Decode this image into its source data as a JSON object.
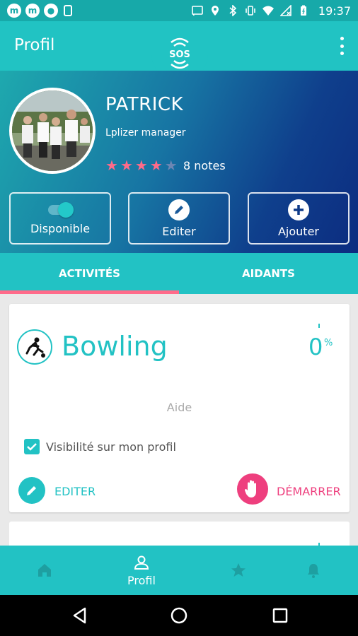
{
  "status_bar": {
    "time": "19:37",
    "app_icons": [
      "m",
      "m"
    ],
    "icons": [
      "cast-icon",
      "location-icon",
      "bluetooth-icon",
      "vibrate-icon",
      "wifi-icon",
      "signal-off-icon",
      "battery-icon"
    ]
  },
  "app_bar": {
    "title": "Profil",
    "logo_text": "SOS",
    "menu_icon": "more-vert-icon"
  },
  "profile": {
    "name": "PATRICK",
    "role": "Lplizer manager",
    "rating": 4,
    "rating_max": 5,
    "notes_label": "8 notes",
    "actions": {
      "available_label": "Disponible",
      "available_on": true,
      "edit_label": "Editer",
      "add_label": "Ajouter"
    }
  },
  "tabs": [
    {
      "label": "ACTIVITÉS",
      "active": true
    },
    {
      "label": "AIDANTS",
      "active": false
    }
  ],
  "activity_card": {
    "name": "Bowling",
    "percent_value": "0",
    "percent_sign": "%",
    "role_label": "Aide",
    "visibility_label": "Visibilité sur mon profil",
    "visibility_checked": true,
    "edit_label": "EDITER",
    "start_label": "DÉMARRER"
  },
  "bottom_nav": {
    "profil_label": "Profil"
  },
  "colors": {
    "primary": "#22c2c4",
    "accent": "#ee3f7e",
    "star": "#ff6b8a"
  }
}
